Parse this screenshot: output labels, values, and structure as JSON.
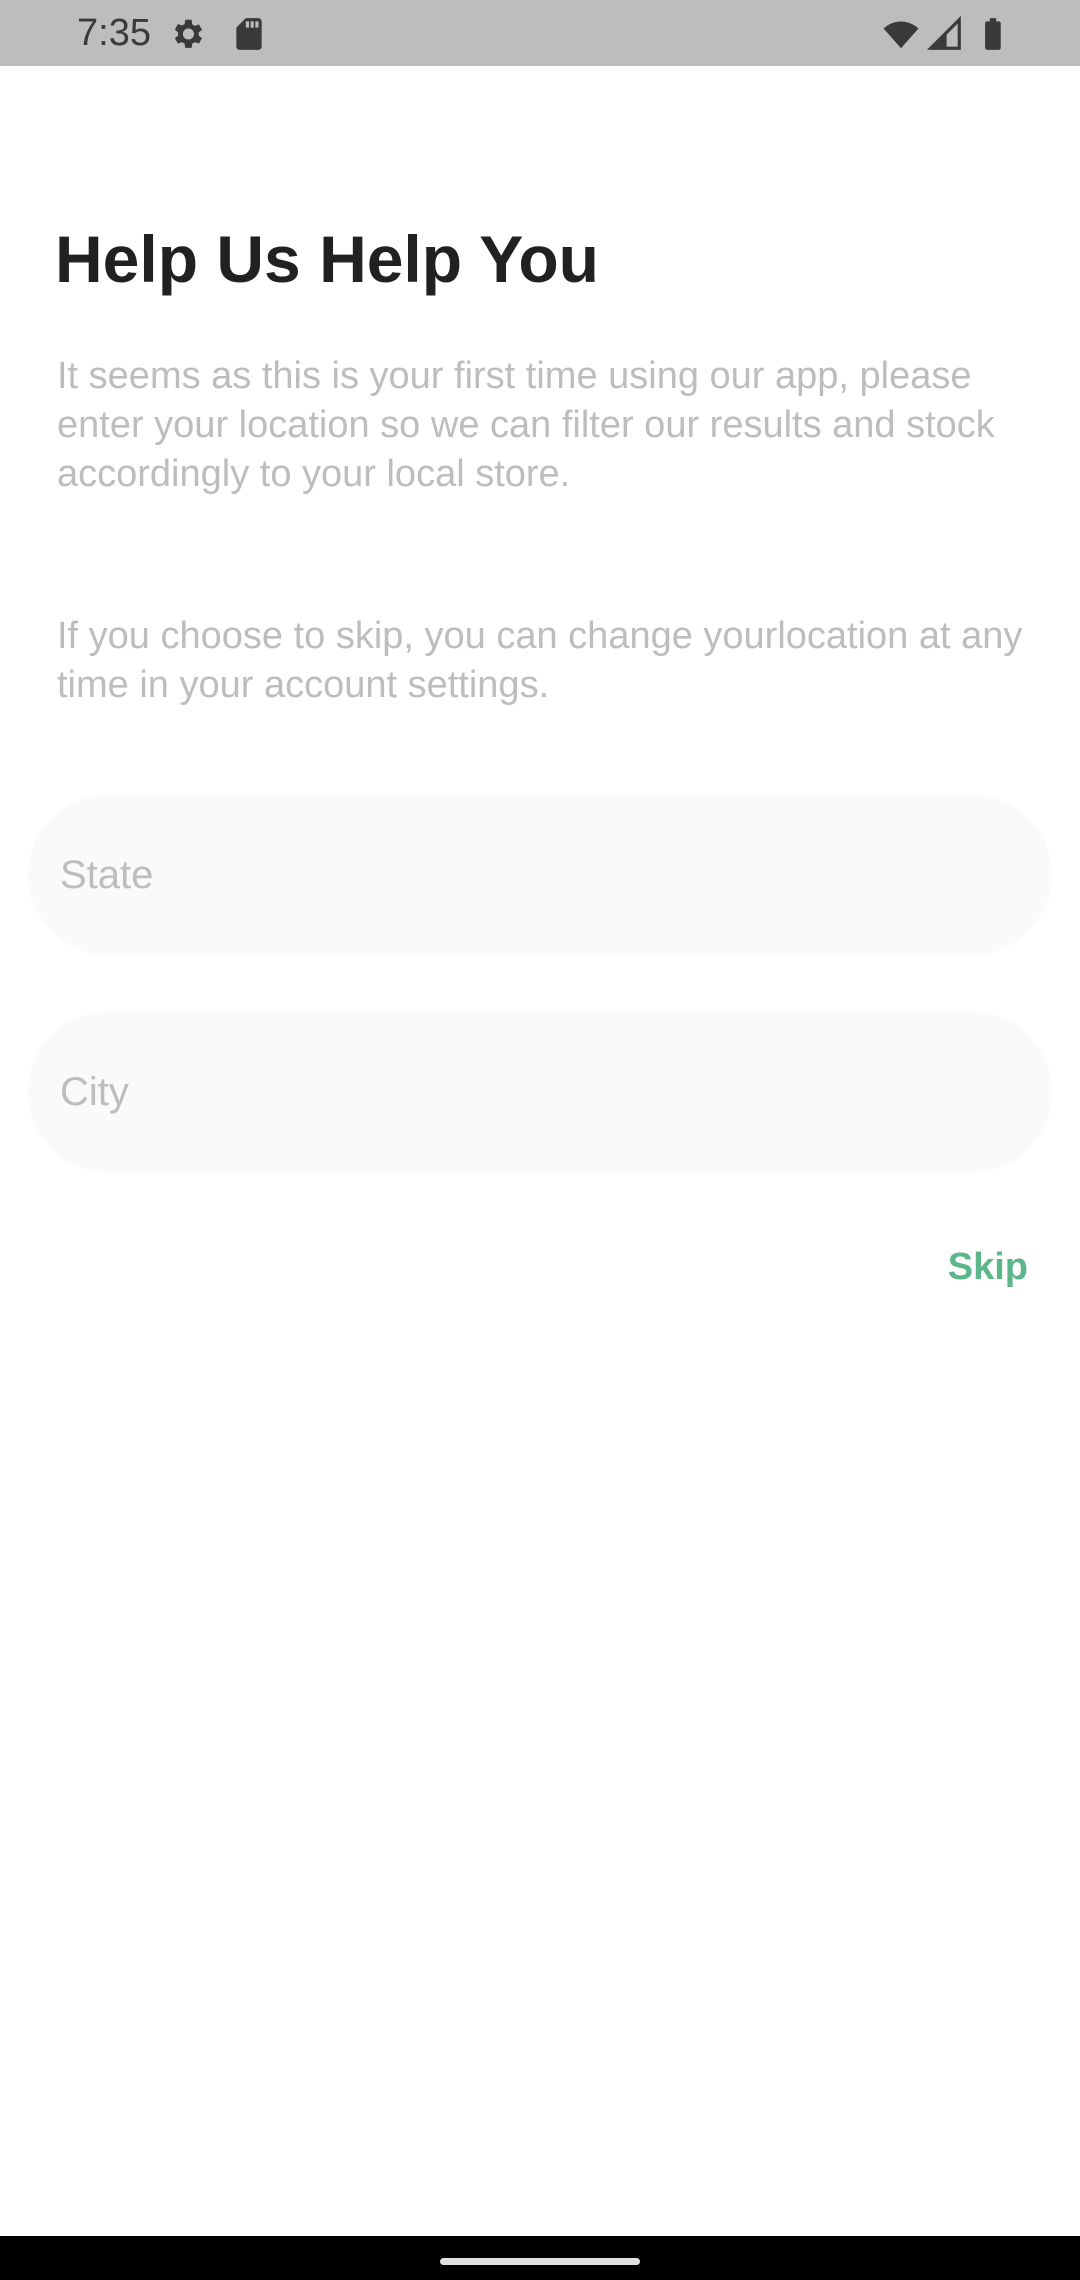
{
  "status_bar": {
    "time": "7:35",
    "icons": [
      "gear-icon",
      "sd-card-icon",
      "wifi-icon",
      "signal-icon",
      "battery-icon"
    ]
  },
  "page": {
    "title": "Help Us Help You",
    "description_1": "It seems as this is your first time using our app, please enter your location so we can filter our results and stock accordingly to your local store.",
    "description_2": "If you choose to skip, you can change yourlocation at any time in your account settings."
  },
  "form": {
    "state": {
      "placeholder": "State",
      "value": ""
    },
    "city": {
      "placeholder": "City",
      "value": ""
    }
  },
  "actions": {
    "skip_label": "Skip"
  },
  "colors": {
    "accent": "#5cb68a",
    "title": "#212121",
    "muted_text": "#bdbdbd",
    "field_background": "#fafafa",
    "status_bar": "#bdbdbd"
  }
}
